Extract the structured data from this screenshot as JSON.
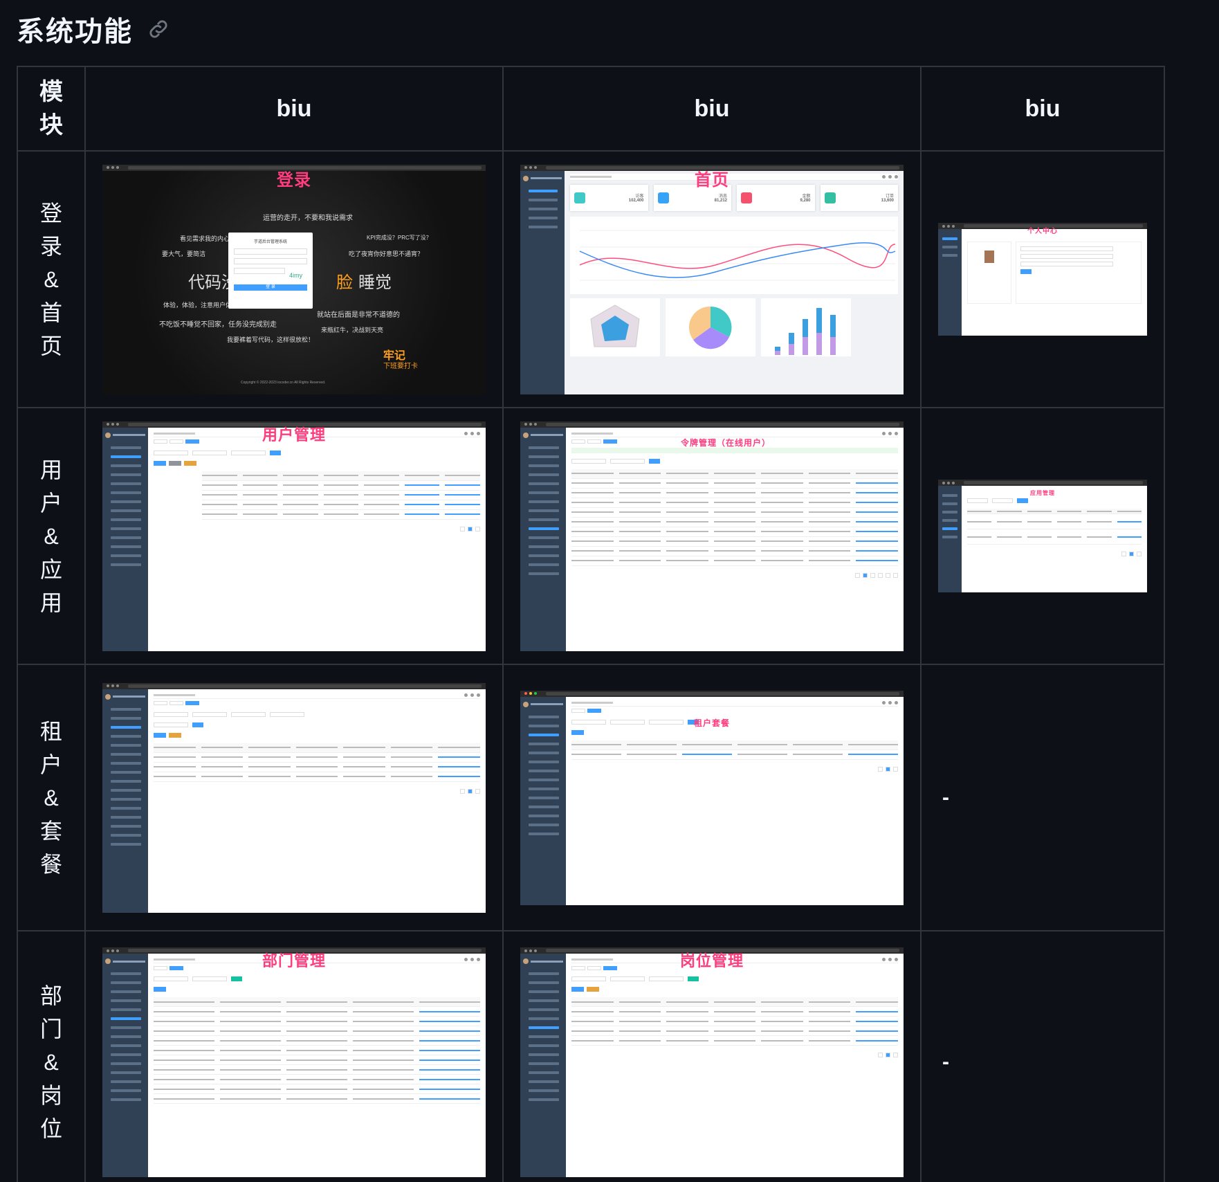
{
  "heading": "系统功能",
  "table": {
    "headers": [
      "模块",
      "biu",
      "biu",
      "biu"
    ],
    "rows": [
      {
        "module": [
          "登",
          "录",
          "&",
          "首",
          "页"
        ]
      },
      {
        "module": [
          "用",
          "户",
          "&",
          "应",
          "用"
        ]
      },
      {
        "module": [
          "租",
          "户",
          "&",
          "套",
          "餐"
        ]
      },
      {
        "module": [
          "部",
          "门",
          "&",
          "岗",
          "位"
        ]
      }
    ],
    "dash": "-"
  },
  "captions": {
    "login": "登录",
    "home": "首页",
    "profile": "个人中心",
    "user": "用户管理",
    "token": "令牌管理（在线用户）",
    "app": "应用管理",
    "tenant_package": "租户套餐",
    "dept": "部门管理",
    "post": "岗位管理"
  },
  "login_screen": {
    "line1": "运营的走开，不要和我说需求",
    "line2": "看见需求我的内心是奔溃的",
    "line3": "KPI完成没？PRC写了没？",
    "line4": "要大气，要简洁",
    "line5": "吃了夜宵你好意思不通宵？",
    "big_left": "代码没写",
    "big_right_accent": "脸",
    "big_right": "睡觉",
    "line6": "体验，体验，注意用户体验！",
    "line7": "不吃饭不睡觉不回家，任务没完成别走",
    "line8": "就站在后面是非常不道德的",
    "line9": "我要裤着写代码，这样很放松！",
    "line10": "来瓶红牛，决战到天亮",
    "stamp_title": "牢记",
    "stamp_sub": "下班要打卡",
    "box_title": "芋道后台管理系统",
    "captcha": "4imy",
    "login_btn": "登 录",
    "copyright": "Copyright © 2022-2023 iocoder.cn All Rights Reserved."
  },
  "home_cards": [
    {
      "label": "访客",
      "value": "102,400",
      "color": "#40c9c6"
    },
    {
      "label": "消息",
      "value": "81,212",
      "color": "#36a3f7"
    },
    {
      "label": "金额",
      "value": "9,280",
      "color": "#f4516c"
    },
    {
      "label": "订单",
      "value": "13,600",
      "color": "#34bfa3"
    }
  ]
}
